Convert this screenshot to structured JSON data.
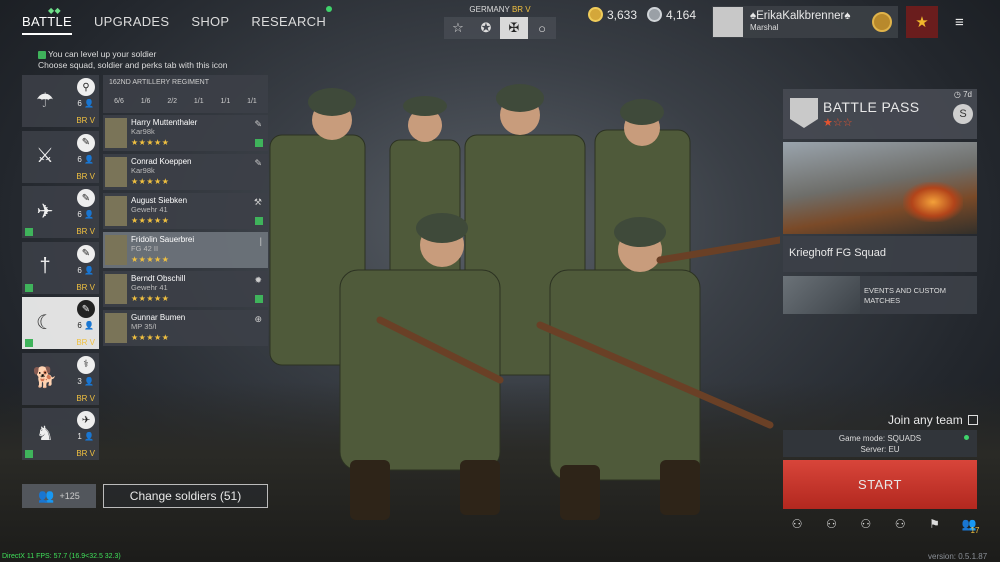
{
  "nav": {
    "tabs": [
      {
        "label": "BATTLE"
      },
      {
        "label": "UPGRADES"
      },
      {
        "label": "SHOP"
      },
      {
        "label": "RESEARCH"
      }
    ],
    "hint_line1": "You can level up your soldier",
    "hint_line2": "Choose squad, soldier and perks tab with this icon"
  },
  "nation": {
    "country": "GERMANY",
    "br": "BR V",
    "buttons": [
      "☆",
      "✪",
      "✠",
      "○"
    ]
  },
  "currency": {
    "gold": "3,633",
    "silver": "4,164"
  },
  "profile": {
    "name": "♠ErikaKalkbrenner♠",
    "rank": "Marshal"
  },
  "squads": [
    {
      "count": "6",
      "br": "BR V",
      "icon": "parachute-icon",
      "cls": "⚲"
    },
    {
      "count": "6",
      "br": "BR V",
      "icon": "crossed-swords-icon",
      "cls": "✎"
    },
    {
      "count": "6",
      "br": "BR V",
      "icon": "wing-emblem-icon",
      "cls": "✎"
    },
    {
      "count": "6",
      "br": "BR V",
      "icon": "sword-emblem-icon",
      "cls": "✎"
    },
    {
      "count": "6",
      "br": "BR V",
      "icon": "crescent-emblem-icon",
      "cls": "✎"
    },
    {
      "count": "3",
      "br": "BR V",
      "icon": "dog-emblem-icon",
      "cls": "⚕"
    },
    {
      "count": "1",
      "br": "BR V",
      "icon": "lion-emblem-icon",
      "cls": "✈"
    }
  ],
  "regiment": {
    "title": "162ND ARTILLERY REGIMENT",
    "stats": [
      "6/6",
      "1/6",
      "2/2",
      "1/1",
      "1/1",
      "1/1"
    ]
  },
  "soldiers": [
    {
      "name": "Harry Muttenthaler",
      "weapon": "Kar98k",
      "stars": "★★★★★"
    },
    {
      "name": "Conrad Koeppen",
      "weapon": "Kar98k",
      "stars": "★★★★★"
    },
    {
      "name": "August Siebken",
      "weapon": "Gewehr 41",
      "stars": "★★★★★"
    },
    {
      "name": "Fridolin Sauerbrei",
      "weapon": "FG 42 II",
      "stars": "★★★★★"
    },
    {
      "name": "Berndt Obschill",
      "weapon": "Gewehr 41",
      "stars": "★★★★★"
    },
    {
      "name": "Gunnar Bumen",
      "weapon": "MP 35/I",
      "stars": "★★★★★"
    }
  ],
  "bottom": {
    "add_count": "+125",
    "change_label": "Change soldiers (51)",
    "debug": "DirectX 11 FPS: 57.7 (16.9<32.5 32.3)",
    "version": "version: 0.5.1.87"
  },
  "battle_pass": {
    "title": "BATTLE PASS",
    "stars": "★☆☆",
    "timer": "7d",
    "currency_icon": "S"
  },
  "promo": {
    "squad_name": "Krieghoff FG Squad",
    "events_label": "EVENTS AND CUSTOM MATCHES"
  },
  "matchmaking": {
    "join_label": "Join any team",
    "mode_line": "Game mode: SQUADS",
    "server_line": "Server: EU",
    "start_label": "START",
    "party_count": "17"
  },
  "colors": {
    "accent_gold": "#f0c040",
    "start_red": "#c8362b",
    "online_green": "#3fd36b"
  }
}
